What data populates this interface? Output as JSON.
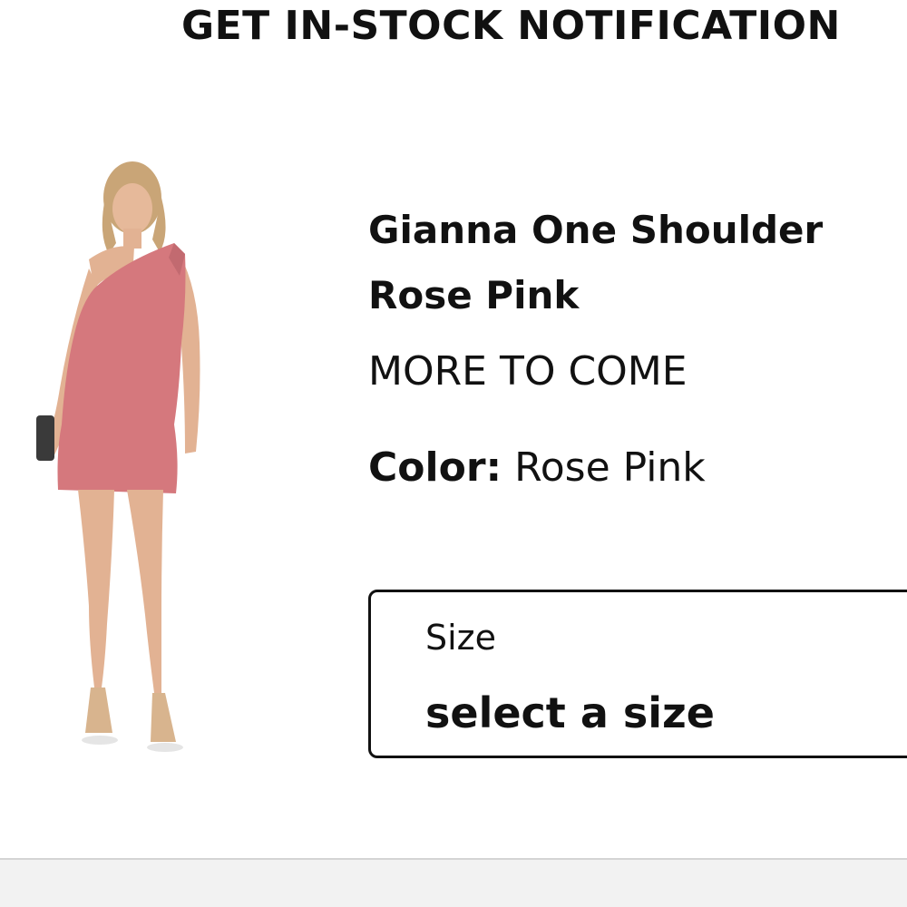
{
  "modal": {
    "title": "GET IN-STOCK NOTIFICATION"
  },
  "product": {
    "name_line1": "Gianna One Shoulder",
    "name_line2": "Rose Pink",
    "availability": "MORE TO COME",
    "color_label": "Color:",
    "color_value": "Rose Pink",
    "dress_color": "#d5787d"
  },
  "size_select": {
    "label": "Size",
    "value": "select a size"
  }
}
